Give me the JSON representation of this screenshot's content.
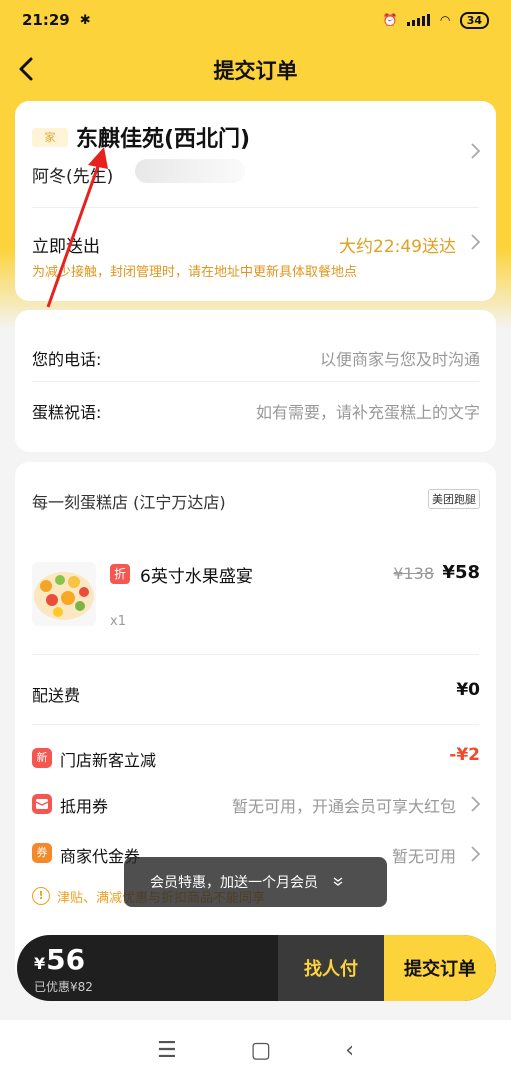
{
  "status_bar": {
    "time": "21:29",
    "bluetooth_icon": "bluetooth-icon",
    "battery": "34"
  },
  "nav": {
    "title": "提交订单",
    "back_icon": "chevron-left-icon"
  },
  "address": {
    "tag": "家",
    "title": "东麒佳苑(西北门)",
    "person": "阿冬(先生)"
  },
  "delivery": {
    "label": "立即送出",
    "time": "大约22:49送达",
    "notice": "为减少接触，封闭管理时，请在地址中更新具体取餐地点"
  },
  "info": {
    "phone_label": "您的电话:",
    "phone_hint": "以便商家与您及时沟通",
    "blessing_label": "蛋糕祝语:",
    "blessing_hint": "如有需要，请补充蛋糕上的文字"
  },
  "order": {
    "shop_name": "每一刻蛋糕店 (江宁万达店)",
    "shop_badge": "美团跑腿",
    "product": {
      "discount_tag": "折",
      "name": "6英寸水果盛宴",
      "old_price": "¥138",
      "new_price": "¥58",
      "qty": "x1"
    },
    "delivery_fee_label": "配送费",
    "delivery_fee": "¥0",
    "promos": [
      {
        "icon": "新",
        "label": "门店新客立减",
        "value": "-¥2",
        "color": "#f4574f"
      },
      {
        "icon": "red-packet-icon",
        "label": "抵用券",
        "hint": "暂无可用，开通会员可享大红包",
        "color": "#f4574f"
      },
      {
        "icon": "券",
        "label": "商家代金券",
        "hint": "暂无可用",
        "color": "#f5892a"
      }
    ],
    "warning": "津贴、满减优惠与折扣商品不能同享"
  },
  "toast": {
    "text": "会员特惠，加送一个月会员"
  },
  "paybar": {
    "total": "56",
    "currency": "¥",
    "discount": "已优惠¥82",
    "friend_pay": "找人付",
    "submit": "提交订单"
  },
  "colors": {
    "brand_yellow": "#fcd33a",
    "accent_orange": "#e0a020",
    "price_red": "#f04a2a"
  }
}
